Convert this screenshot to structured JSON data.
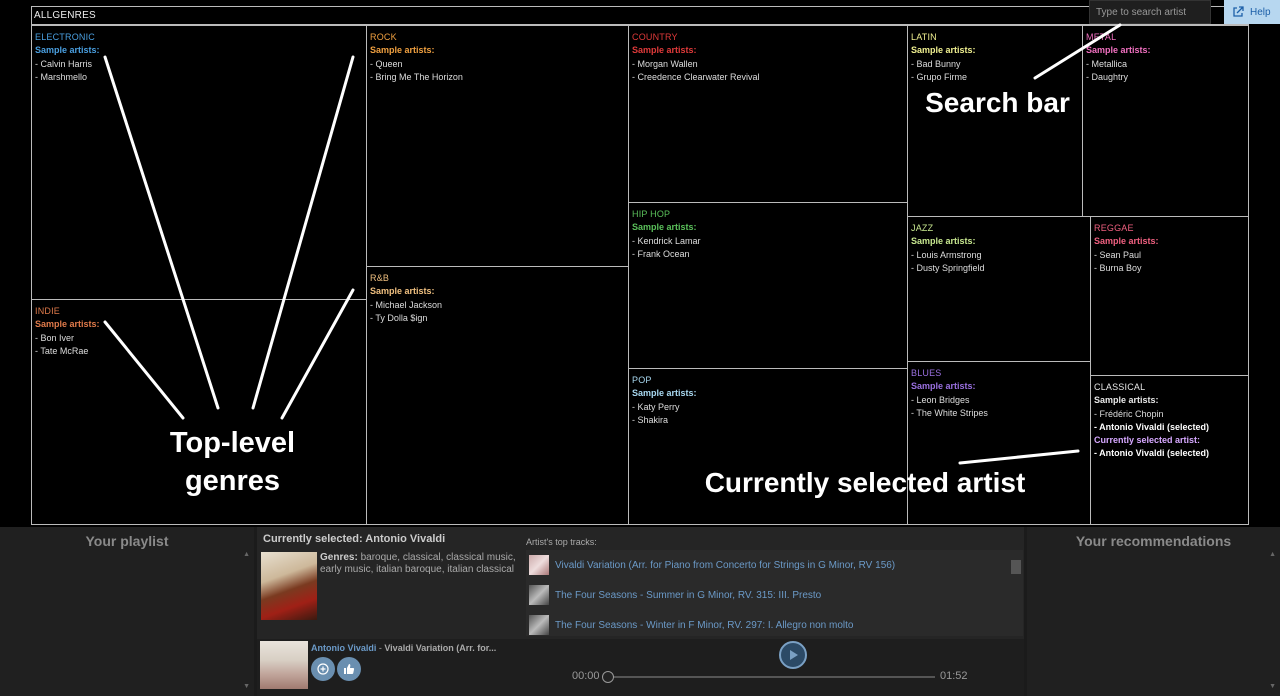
{
  "treemap": {
    "root_label": "ALLGENRES",
    "sample_label": "Sample artists:",
    "current_label": "Currently selected artist:",
    "genres": [
      {
        "name": "ELECTRONIC",
        "color": "#4a9fe0",
        "artists": [
          "- Calvin Harris",
          "- Marshmello"
        ]
      },
      {
        "name": "INDIE",
        "color": "#e07a4a",
        "artists": [
          "- Bon Iver",
          "- Tate McRae"
        ]
      },
      {
        "name": "ROCK",
        "color": "#f0a040",
        "artists": [
          "- Queen",
          "- Bring Me The Horizon"
        ]
      },
      {
        "name": "R&B",
        "color": "#f0c080",
        "artists": [
          "- Michael Jackson",
          "- Ty Dolla $ign"
        ]
      },
      {
        "name": "COUNTRY",
        "color": "#e03a3a",
        "artists": [
          "- Morgan Wallen",
          "- Creedence Clearwater Revival"
        ]
      },
      {
        "name": "HIP HOP",
        "color": "#5ac05a",
        "artists": [
          "- Kendrick Lamar",
          "- Frank Ocean"
        ]
      },
      {
        "name": "POP",
        "color": "#a8d8f0",
        "artists": [
          "- Katy Perry",
          "- Shakira"
        ]
      },
      {
        "name": "LATIN",
        "color": "#f0f090",
        "artists": [
          "- Bad Bunny",
          "- Grupo Firme"
        ]
      },
      {
        "name": "METAL",
        "color": "#f070c0",
        "artists": [
          "- Metallica",
          "- Daughtry"
        ]
      },
      {
        "name": "JAZZ",
        "color": "#c8e890",
        "artists": [
          "- Louis Armstrong",
          "- Dusty Springfield"
        ]
      },
      {
        "name": "REGGAE",
        "color": "#f06080",
        "artists": [
          "- Sean Paul",
          "- Burna Boy"
        ]
      },
      {
        "name": "BLUES",
        "color": "#9a70e0",
        "artists": [
          "- Leon Bridges",
          "- The White Stripes"
        ]
      },
      {
        "name": "CLASSICAL",
        "color": "#e8e8e8",
        "artists": [
          "- Frédéric Chopin",
          "- Antonio Vivaldi (selected)"
        ],
        "current": "- Antonio Vivaldi (selected)"
      }
    ]
  },
  "search": {
    "placeholder": "Type to search artist"
  },
  "help": {
    "label": "Help"
  },
  "annotations": {
    "top_level_line1": "Top-level",
    "top_level_line2": "genres",
    "search_bar": "Search bar",
    "selected_artist": "Currently selected artist"
  },
  "playlist": {
    "title": "Your playlist"
  },
  "recommendations": {
    "title": "Your recommendations"
  },
  "artist_panel": {
    "title": "Currently selected: Antonio Vivaldi",
    "genres_label": "Genres:",
    "genres_value": " baroque, classical, classical music, early music, italian baroque, italian classical",
    "tracks_title": "Artist's top tracks:",
    "tracks": [
      "Vivaldi Variation (Arr. for Piano from Concerto for Strings in G Minor, RV 156)",
      "The Four Seasons - Summer in G Minor, RV. 315: III. Presto",
      "The Four Seasons - Winter in F Minor, RV. 297: I. Allegro non molto"
    ]
  },
  "player": {
    "artist": "Antonio Vivaldi",
    "separator": " - ",
    "track": "Vivaldi Variation (Arr. for...",
    "time_current": "00:00",
    "time_total": "01:52",
    "progress": 0
  },
  "colors": {
    "sample_label_default": "#4a9fe0",
    "accent": "#6b9ac8"
  }
}
